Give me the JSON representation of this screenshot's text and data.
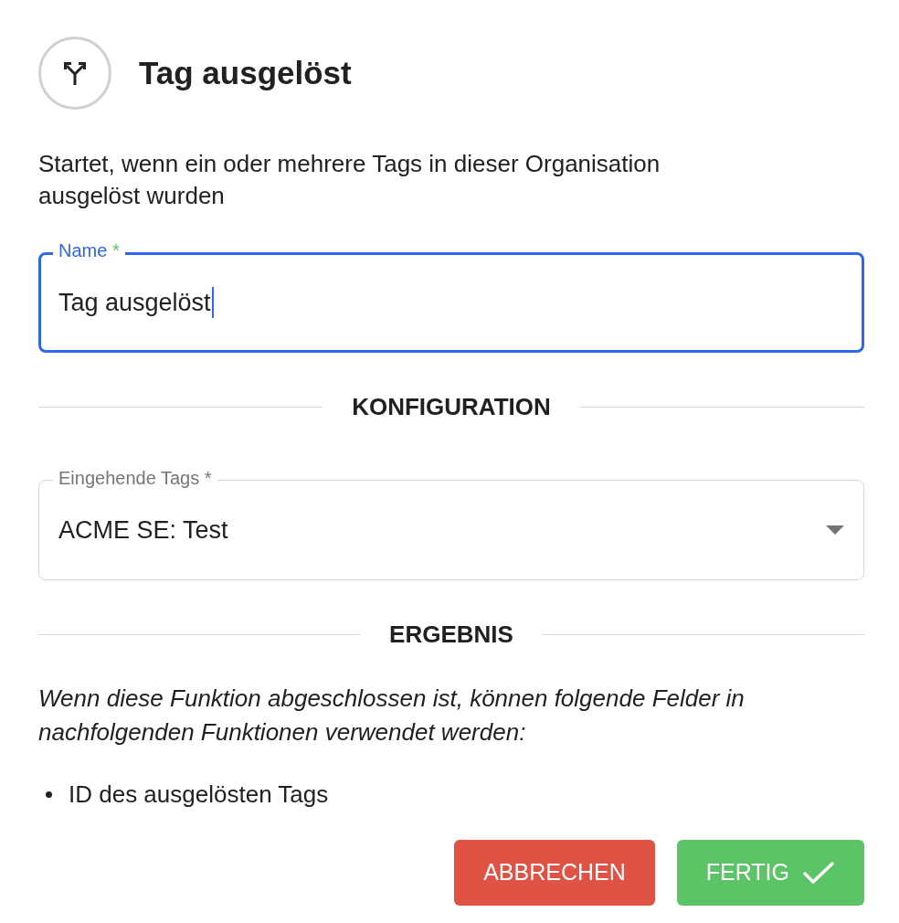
{
  "header": {
    "title": "Tag ausgelöst"
  },
  "description": "Startet, wenn ein oder mehrere Tags in dieser Organisation ausgelöst wurden",
  "name_field": {
    "label": "Name",
    "required_mark": "*",
    "value": "Tag ausgelöst",
    "focused": true
  },
  "configuration": {
    "heading": "KONFIGURATION",
    "select": {
      "label": "Eingehende Tags *",
      "value": "ACME SE: Test",
      "focused": false
    }
  },
  "result": {
    "heading": "ERGEBNIS",
    "intro": "Wenn diese Funktion abgeschlossen ist, können folgende Felder in nachfolgenden Funktionen verwendet werden:",
    "fields": [
      "ID des ausgelösten Tags"
    ]
  },
  "buttons": [
    {
      "label": "ABBRECHEN",
      "kind": "cancel"
    },
    {
      "label": "FERTIG",
      "kind": "confirm"
    }
  ]
}
